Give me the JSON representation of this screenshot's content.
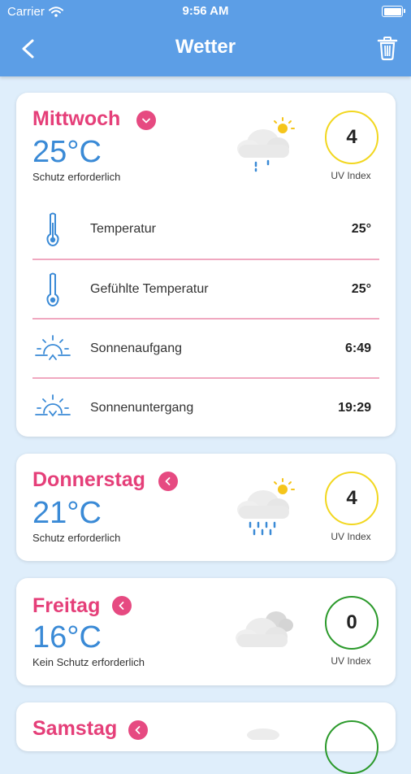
{
  "status_bar": {
    "carrier": "Carrier",
    "time": "9:56 AM"
  },
  "nav": {
    "title": "Wetter"
  },
  "colors": {
    "header": "#5c9ee6",
    "day_text": "#e53f79",
    "temp_text": "#3a8ad6",
    "uv_moderate": "#f2d720",
    "uv_low": "#2c9a2c"
  },
  "days": [
    {
      "day": "Mittwoch",
      "temp": "25°C",
      "protection": "Schutz erforderlich",
      "uv_value": "4",
      "uv_label": "UV Index",
      "icon": "partly-cloudy-drizzle-icon",
      "expanded": true,
      "details": [
        {
          "label": "Temperatur",
          "value": "25°",
          "icon": "thermometer-icon"
        },
        {
          "label": "Gefühlte Temperatur",
          "value": "25°",
          "icon": "thermometer-icon"
        },
        {
          "label": "Sonnenaufgang",
          "value": "6:49",
          "icon": "sunrise-icon"
        },
        {
          "label": "Sonnenuntergang",
          "value": "19:29",
          "icon": "sunset-icon"
        }
      ]
    },
    {
      "day": "Donnerstag",
      "temp": "21°C",
      "protection": "Schutz erforderlich",
      "uv_value": "4",
      "uv_label": "UV Index",
      "icon": "partly-cloudy-rain-icon",
      "expanded": false
    },
    {
      "day": "Freitag",
      "temp": "16°C",
      "protection": "Kein Schutz erforderlich",
      "uv_value": "0",
      "uv_label": "UV Index",
      "icon": "cloudy-icon",
      "expanded": false
    },
    {
      "day": "Samstag",
      "expanded": false
    }
  ]
}
